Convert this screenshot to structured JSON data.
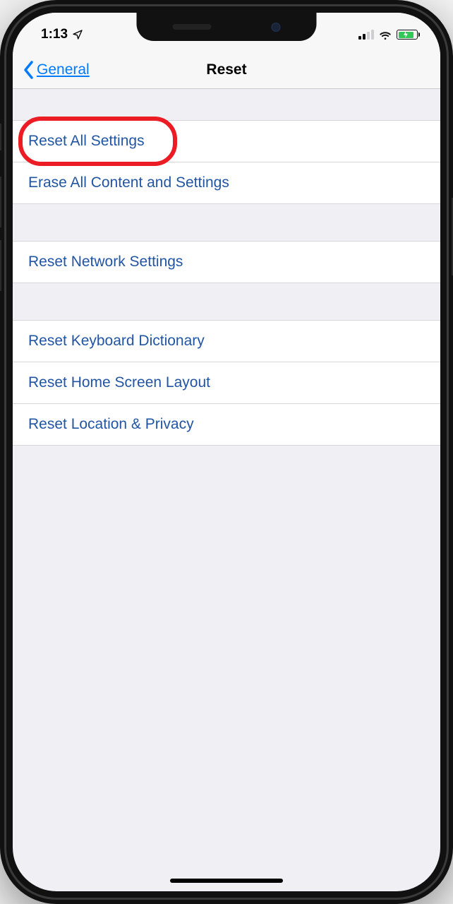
{
  "status": {
    "time": "1:13"
  },
  "nav": {
    "back_label": "General",
    "title": "Reset"
  },
  "groups": [
    {
      "cells": [
        "Reset All Settings",
        "Erase All Content and Settings"
      ]
    },
    {
      "cells": [
        "Reset Network Settings"
      ]
    },
    {
      "cells": [
        "Reset Keyboard Dictionary",
        "Reset Home Screen Layout",
        "Reset Location & Privacy"
      ]
    }
  ],
  "highlight": {
    "target": "reset-all-settings"
  },
  "colors": {
    "link": "#2155a4",
    "accent": "#007aff",
    "highlight": "#ec1c24"
  }
}
